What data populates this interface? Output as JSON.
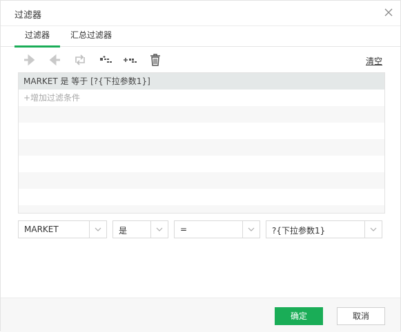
{
  "dialog": {
    "title": "过滤器"
  },
  "tabs": [
    {
      "label": "过滤器",
      "active": true
    },
    {
      "label": "汇总过滤器",
      "active": false
    }
  ],
  "toolbar": {
    "icons": [
      "arrow-right-icon",
      "arrow-left-icon",
      "swap-icon",
      "add-child-condition-icon",
      "add-condition-icon",
      "delete-icon"
    ],
    "clear_label": "清空"
  },
  "conditions": {
    "items": [
      {
        "text": "MARKET 是 等于 [?{下拉参数1}]"
      }
    ],
    "add_label": "+增加过滤条件"
  },
  "editor": {
    "field": "MARKET",
    "negation": "是",
    "operator": "=",
    "value": "?{下拉参数1}"
  },
  "footer": {
    "ok_label": "确定",
    "cancel_label": "取消"
  },
  "colors": {
    "accent": "#1aad57",
    "selected_row": "#e4e8e8",
    "disabled_icon": "#cfcfcf"
  }
}
